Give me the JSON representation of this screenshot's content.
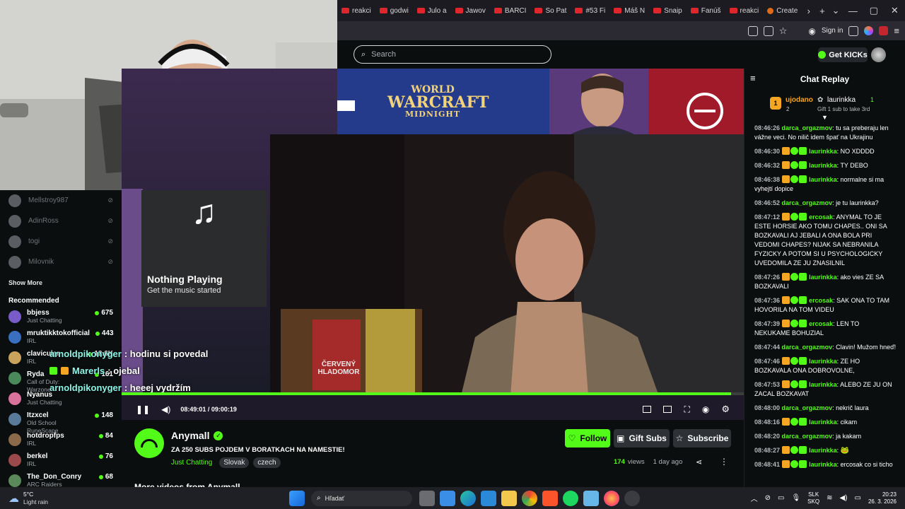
{
  "browser": {
    "tabs": [
      {
        "label": "reakci",
        "icon": "youtube-icon"
      },
      {
        "label": "godwi",
        "icon": "youtube-icon"
      },
      {
        "label": "Julo a",
        "icon": "youtube-icon"
      },
      {
        "label": "Jawov",
        "icon": "youtube-icon"
      },
      {
        "label": "BARCI",
        "icon": "youtube-icon"
      },
      {
        "label": "So Pat",
        "icon": "youtube-icon"
      },
      {
        "label": "#53 Fi",
        "icon": "youtube-icon"
      },
      {
        "label": "Máš N",
        "icon": "youtube-icon"
      },
      {
        "label": "Snaip",
        "icon": "youtube-icon"
      },
      {
        "label": "Fanúš",
        "icon": "youtube-icon"
      },
      {
        "label": "reakci",
        "icon": "youtube-icon"
      },
      {
        "label": "Create",
        "icon": "web-icon"
      }
    ],
    "sign_in": "Sign in"
  },
  "header": {
    "search_placeholder": "Search",
    "get_kicks": "Get KICKs"
  },
  "sidebar": {
    "followed": [
      {
        "name": "Mellstroy987"
      },
      {
        "name": "AdinRoss"
      },
      {
        "name": "togi"
      },
      {
        "name": "Milovnik"
      }
    ],
    "show_more": "Show More",
    "recommended_title": "Recommended",
    "recommended": [
      {
        "name": "bbjess",
        "category": "Just Chatting",
        "viewers": "675"
      },
      {
        "name": "mruktikktokofficial",
        "category": "IRL",
        "viewers": "443"
      },
      {
        "name": "clavicular",
        "category": "IRL",
        "viewers": "12.6K"
      },
      {
        "name": "Ryda",
        "category": "Call of Duty: Warzone",
        "viewers": "161"
      },
      {
        "name": "Nyanus",
        "category": "Just Chatting",
        "viewers": ""
      },
      {
        "name": "Itzxcel",
        "category": "Old School RuneScape",
        "viewers": "148"
      },
      {
        "name": "hotdropfps",
        "category": "IRL",
        "viewers": "84"
      },
      {
        "name": "berkel",
        "category": "IRL",
        "viewers": "76"
      },
      {
        "name": "The_Don_Conry",
        "category": "ARC Raiders",
        "viewers": "68"
      }
    ]
  },
  "video": {
    "banner_title_1": "WORLD",
    "banner_title_2": "WARCRAFT",
    "banner_title_3": "MIDNIGHT",
    "book_title": "ČERVENÝ HLADOMOR",
    "now_playing": "Nothing Playing",
    "now_playing_sub": "Get the music started",
    "overlay_chat": [
      {
        "user": "arnoldpikonyger",
        "text": ": hodinu si povedal"
      },
      {
        "user": "Marerls",
        "text": ": ojebal"
      },
      {
        "user": "arnoldpikonyger",
        "text": ": heeej vydržím"
      }
    ],
    "time": "08:49:01 / 09:00:19",
    "progress": 0.979
  },
  "channel": {
    "name": "Anymall",
    "title": "ZA 250 SUBS POJDEM V BORATKACH NA NAMESTIE!",
    "category": "Just Chatting",
    "tags": [
      "Slovak",
      "czech"
    ],
    "follow": "Follow",
    "gift_subs": "Gift Subs",
    "subscribe": "Subscribe",
    "views_count": "174",
    "views_label": "views",
    "ago": "1 day ago",
    "more_videos": "More videos from Anymall"
  },
  "chat": {
    "title": "Chat Replay",
    "leader_1_name": "ujodano",
    "leader_1_count": "2",
    "leader_2_name": "laurinkka",
    "leader_2_count": "1",
    "leader_2_sub": "Gift 1 sub to take 3rd",
    "messages": [
      {
        "time": "08:46:26",
        "user": "darca_orgazmov",
        "color": "#53fc18",
        "badges": 0,
        "text": "tu sa preberaju len vážne veci. No nilič idem špať na Ukrajinu"
      },
      {
        "time": "08:46:30",
        "user": "laurinkka",
        "color": "#53fc18",
        "badges": 3,
        "text": "NO XDDDD"
      },
      {
        "time": "08:46:32",
        "user": "laurinkka",
        "color": "#53fc18",
        "badges": 3,
        "text": "TY DEBO"
      },
      {
        "time": "08:46:38",
        "user": "laurinkka",
        "color": "#53fc18",
        "badges": 3,
        "text": "normalne si ma vyhejtí dopice"
      },
      {
        "time": "08:46:52",
        "user": "darca_orgazmov",
        "color": "#53fc18",
        "badges": 0,
        "text": "je tu laurinkka?"
      },
      {
        "time": "08:47:12",
        "user": "ercosak",
        "color": "#53fc18",
        "badges": 3,
        "text": "ANYMAL TO JE ESTE HORSIE AKO TOMU CHAPES.. ONI SA BOZKAVALI AJ JEBALI A ONA BOLA PRI VEDOMI CHAPES? NIJAK SA NEBRANILA FYZICKY A POTOM SI U PSYCHOLOGICKY UVEDOMILA ZE JU ZNASILNIL"
      },
      {
        "time": "08:47:26",
        "user": "laurinkka",
        "color": "#53fc18",
        "badges": 3,
        "text": "ako vies ZE SA BOZKAVALI"
      },
      {
        "time": "08:47:36",
        "user": "ercosak",
        "color": "#53fc18",
        "badges": 3,
        "text": "SAK ONA TO TAM HOVORILA NA TOM VIDEU"
      },
      {
        "time": "08:47:39",
        "user": "ercosak",
        "color": "#53fc18",
        "badges": 3,
        "text": "LEN TO NEKUKAME BOHUZIAL"
      },
      {
        "time": "08:47:44",
        "user": "darca_orgazmov",
        "color": "#53fc18",
        "badges": 0,
        "text": "Clavin! Mužom hneď!"
      },
      {
        "time": "08:47:46",
        "user": "laurinkka",
        "color": "#53fc18",
        "badges": 3,
        "text": "ZE HO BOZKAVALA ONA DOBROVOLNE,"
      },
      {
        "time": "08:47:53",
        "user": "laurinkka",
        "color": "#53fc18",
        "badges": 3,
        "text": "ALEBO ZE JU ON ZACAL BOZKAVAT"
      },
      {
        "time": "08:48:00",
        "user": "darca_orgazmov",
        "color": "#53fc18",
        "badges": 0,
        "text": "nekrič laura"
      },
      {
        "time": "08:48:16",
        "user": "laurinkka",
        "color": "#53fc18",
        "badges": 3,
        "text": "cikam"
      },
      {
        "time": "08:48:20",
        "user": "darca_orgazmov",
        "color": "#53fc18",
        "badges": 0,
        "text": "ja kakam"
      },
      {
        "time": "08:48:27",
        "user": "laurinkka",
        "color": "#53fc18",
        "badges": 3,
        "text": ""
      },
      {
        "time": "08:48:41",
        "user": "laurinkka",
        "color": "#53fc18",
        "badges": 3,
        "text": "ercosak co si ticho"
      }
    ]
  },
  "taskbar": {
    "weather_temp": "5°C",
    "weather_desc": "Light rain",
    "search": "Hľadať",
    "lang_1": "SLK",
    "lang_2": "SKQ",
    "time": "20:23",
    "date": "26. 3. 2026"
  }
}
